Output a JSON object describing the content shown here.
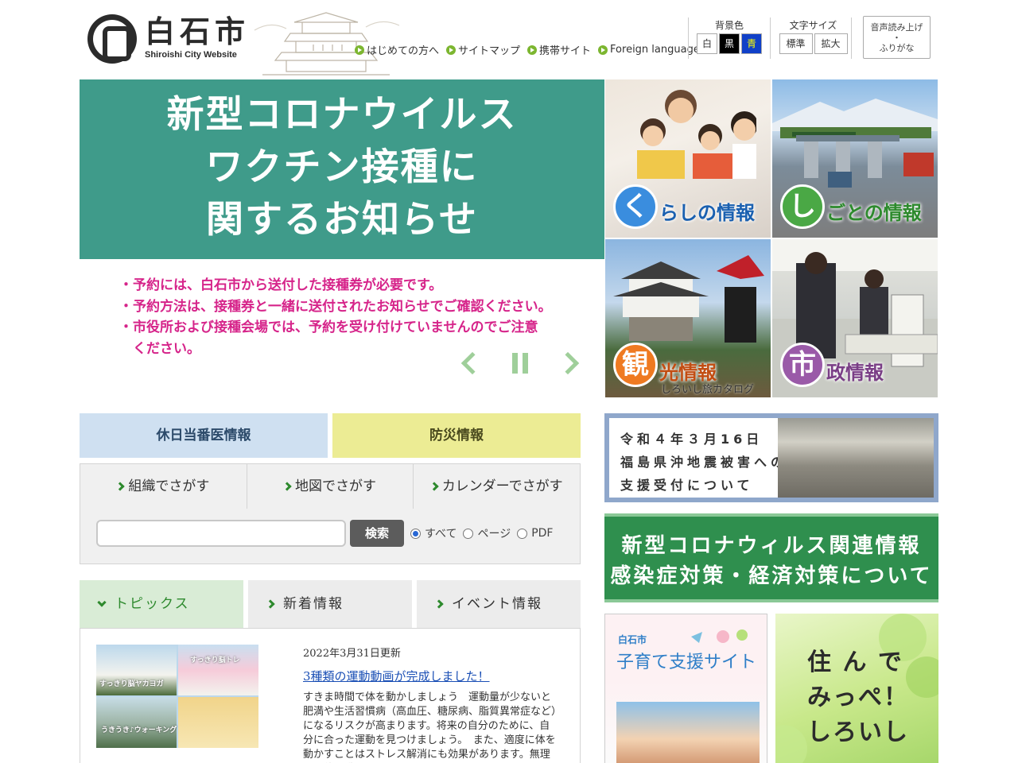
{
  "header": {
    "logo_name": "白石市",
    "logo_sub": "Shiroishi City Website",
    "links": [
      "はじめての方へ",
      "サイトマップ",
      "携帯サイト",
      "Foreign language"
    ],
    "bgcolor": {
      "title": "背景色",
      "options": [
        "白",
        "黒",
        "青"
      ]
    },
    "fontsize": {
      "title": "文字サイズ",
      "options": [
        "標準",
        "拡大"
      ]
    },
    "voice": {
      "line1": "音声読み上げ",
      "line2": "・",
      "line3": "ふりがな"
    }
  },
  "hero": {
    "headline": [
      "新型コロナウイルス",
      "ワクチン接種に",
      "関するお知らせ"
    ],
    "notes": [
      "・予約には、白石市から送付した接種券が必要です。",
      "・予約方法は、接種券と一緒に送付されたお知らせでご確認ください。",
      "・市役所および接種会場では、予約を受け付けていませんのでご注意",
      "　ください。"
    ]
  },
  "tiles": [
    {
      "badge": "く",
      "label": "らしの情報",
      "sub": ""
    },
    {
      "badge": "し",
      "label": "ごとの情報",
      "sub": ""
    },
    {
      "badge": "観",
      "label": "光情報",
      "sub": "しろいし旅カタログ"
    },
    {
      "badge": "市",
      "label": "政情報",
      "sub": ""
    }
  ],
  "info_buttons": {
    "holiday": "休日当番医情報",
    "bousai": "防災情報"
  },
  "search": {
    "tabs": [
      "組織でさがす",
      "地図でさがす",
      "カレンダーでさがす"
    ],
    "button": "検索",
    "scopes": [
      {
        "label": "すべて",
        "checked": true
      },
      {
        "label": "ページ",
        "checked": false
      },
      {
        "label": "PDF",
        "checked": false
      }
    ]
  },
  "topics": {
    "tabs": [
      "トピックス",
      "新着情報",
      "イベント情報"
    ],
    "active_tab": 0,
    "item": {
      "date": "2022年3月31日更新",
      "title": "3種類の運動動画が完成しました！",
      "desc": "すきま時間で体を動かしましょう　運動量が少ないと肥満や生活習慣病（高血圧、糖尿病、脂質異常症など）になるリスクが高まります。将来の自分のために、自分に合った運動を見つけましょう。　また、適度に体を動かすことはストレス解消にも効果があります。無理なく体を動かして",
      "image_captions": [
        "すっきり脳トレ",
        "すっきり脳ヤカヨガ",
        "うきうき♪ウォーキング"
      ]
    }
  },
  "side": {
    "quake": [
      "令和４年３月16日",
      "福島県沖地震被害への",
      "支援受付について"
    ],
    "corona": [
      "新型コロナウィルス関連情報",
      "感染症対策・経済対策について"
    ],
    "child_small": "白石市",
    "child_title": "子育て支援サイト",
    "live": [
      "住 ん で",
      "みっぺ！",
      "しろいし"
    ]
  },
  "colors": {
    "hero_green": "#3f9b8a",
    "hero_note_pink": "#d6248a",
    "link_green": "#7cb630",
    "holiday_bg": "#cfe0f1",
    "bousai_bg": "#ecec94",
    "corona_green": "#2f8f4e",
    "topic_active": "#d9ecd6"
  }
}
